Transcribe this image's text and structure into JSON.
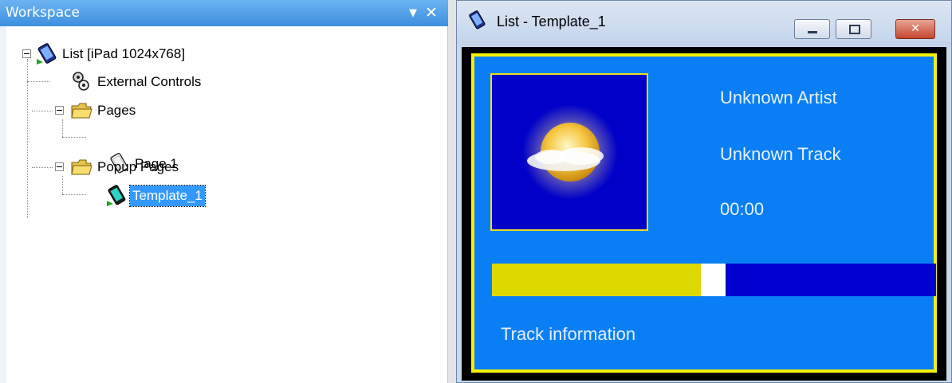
{
  "workspace": {
    "title": "Workspace",
    "tree": {
      "root": {
        "label": "List [iPad 1024x768]",
        "icon": "device-tablet-icon"
      },
      "external_controls": {
        "label": "External Controls",
        "icon": "controls-icon"
      },
      "pages": {
        "label": "Pages",
        "icon": "folder-icon"
      },
      "page1": {
        "label": "Page 1",
        "icon": "page-icon"
      },
      "popup_pages": {
        "label": "Popup Pages",
        "icon": "folder-icon"
      },
      "template1": {
        "label": "Template_1",
        "icon": "popup-page-icon",
        "selected": true
      }
    }
  },
  "preview": {
    "title": "List - Template_1",
    "artist": "Unknown Artist",
    "track": "Unknown Track",
    "time": "00:00",
    "progress": 0.47,
    "track_info": "Track information",
    "album_art": "weather-sun-cloud-icon"
  },
  "colors": {
    "header_blue": "#4a9be6",
    "selection": "#3399ff",
    "panel_blue": "#0a7ff5",
    "panel_border": "#f5f000",
    "dark_blue": "#0000c8",
    "progress_fill": "#dcd800"
  }
}
